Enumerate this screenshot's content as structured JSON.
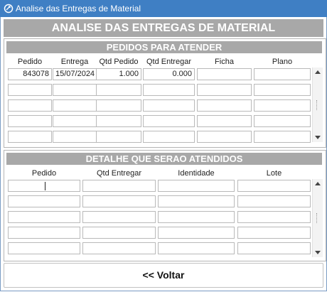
{
  "window": {
    "title": "Analise das Entregas de Material",
    "icon": "app-icon"
  },
  "header": {
    "title": "ANALISE DAS ENTREGAS DE MATERIAL"
  },
  "pedidos_panel": {
    "title": "PEDIDOS PARA ATENDER",
    "columns": [
      "Pedido",
      "Entrega",
      "Qtd Pedido",
      "Qtd Entregar",
      "Ficha",
      "Plano"
    ],
    "rows": [
      [
        "843078",
        "15/07/2024",
        "1.000",
        "0.000",
        "",
        ""
      ],
      [
        "",
        "",
        "",
        "",
        "",
        ""
      ],
      [
        "",
        "",
        "",
        "",
        "",
        ""
      ],
      [
        "",
        "",
        "",
        "",
        "",
        ""
      ],
      [
        "",
        "",
        "",
        "",
        "",
        ""
      ]
    ]
  },
  "detalhe_panel": {
    "title": "DETALHE QUE SERAO ATENDIDOS",
    "columns": [
      "Pedido",
      "Qtd Entregar",
      "Identidade",
      "Lote"
    ],
    "rows": [
      [
        "",
        "",
        "",
        ""
      ],
      [
        "",
        "",
        "",
        ""
      ],
      [
        "",
        "",
        "",
        ""
      ],
      [
        "",
        "",
        "",
        ""
      ],
      [
        "",
        "",
        "",
        ""
      ]
    ]
  },
  "footer": {
    "back_label": "<< Voltar"
  },
  "icons": {
    "scroll_up": "scroll-up-icon",
    "scroll_down": "scroll-down-icon"
  }
}
